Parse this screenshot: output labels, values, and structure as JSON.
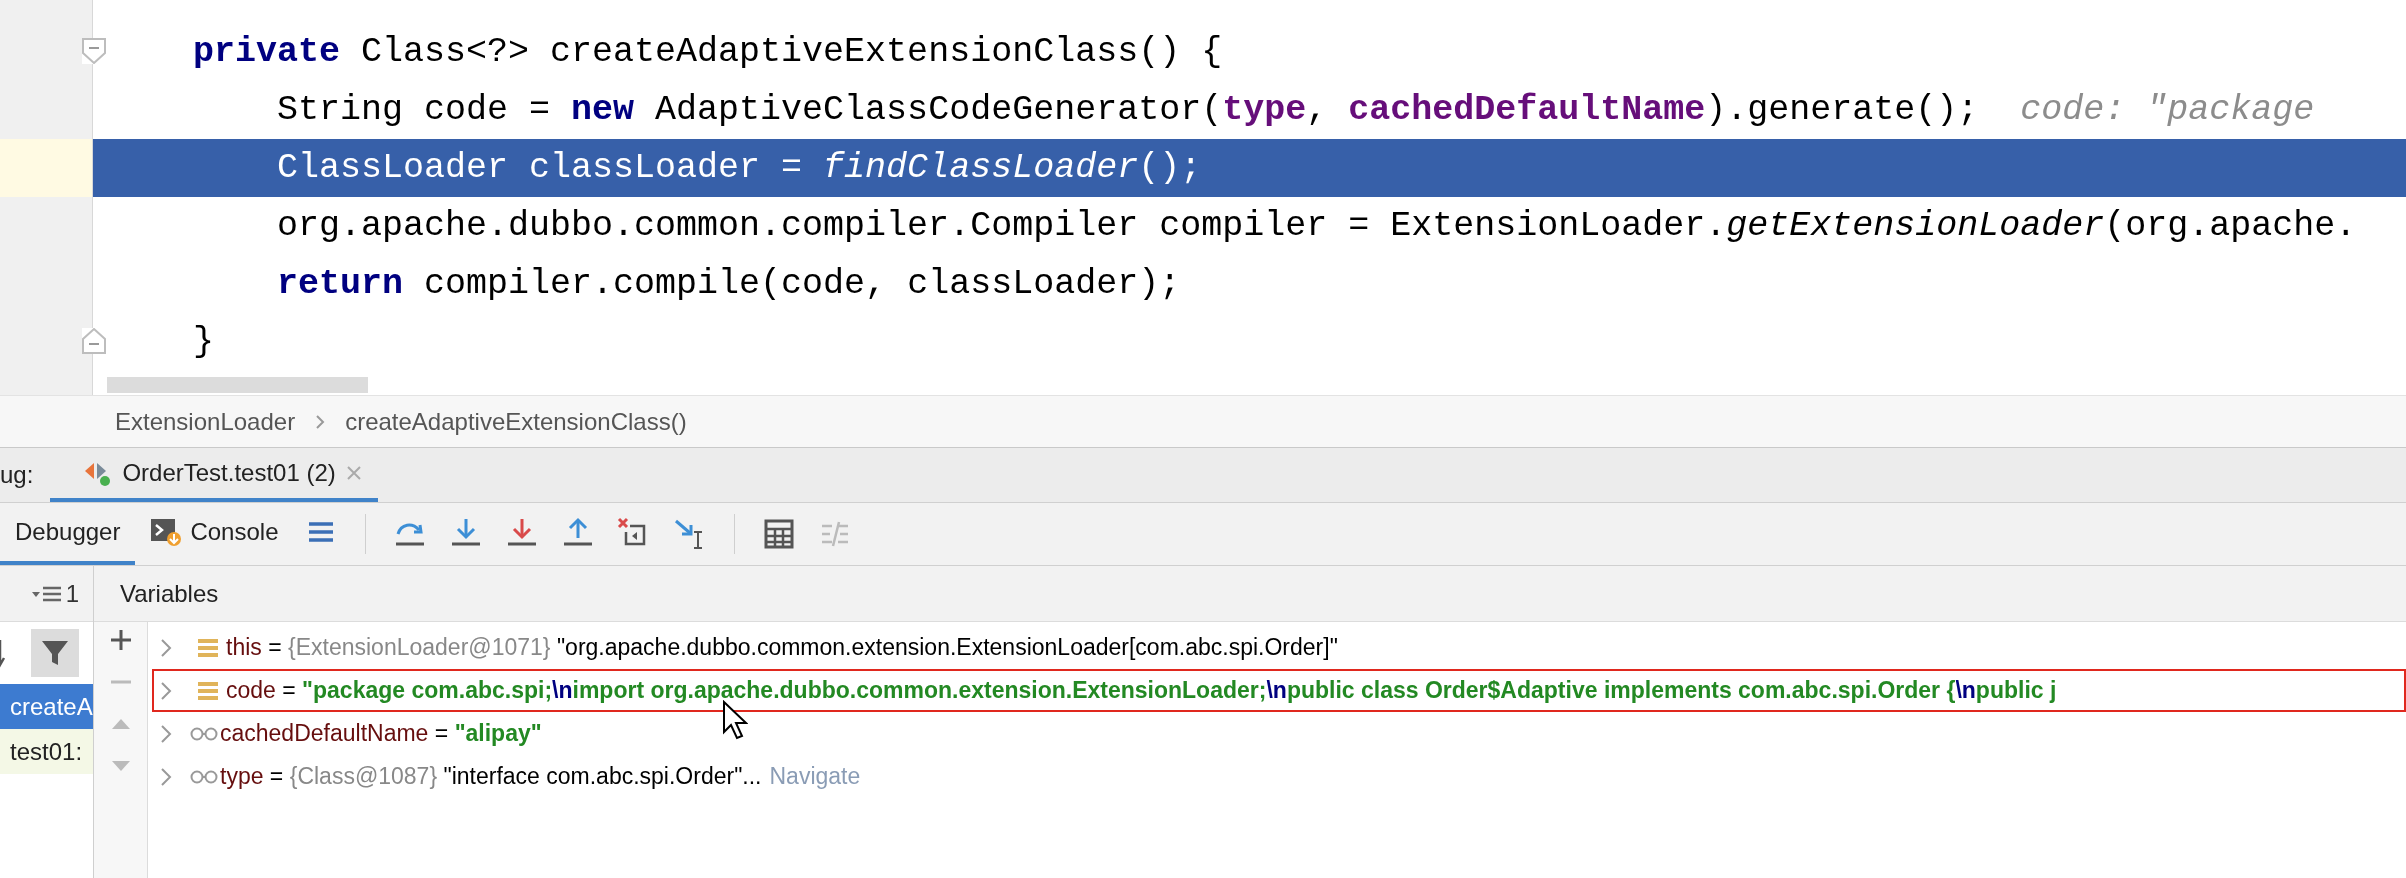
{
  "editor": {
    "lines": [
      {
        "segments": [
          {
            "text": "private",
            "kind": "keyword"
          },
          {
            "text": " Class<?> createAdaptiveExtensionClass() {",
            "kind": "plain"
          }
        ],
        "highlighted": false,
        "kind": "fold_start"
      },
      {
        "segments": [
          {
            "text": "    String code = ",
            "kind": "plain"
          },
          {
            "text": "new",
            "kind": "keyword"
          },
          {
            "text": " AdaptiveClassCodeGenerator(",
            "kind": "plain"
          },
          {
            "text": "type",
            "kind": "field"
          },
          {
            "text": ", ",
            "kind": "plain"
          },
          {
            "text": "cachedDefaultName",
            "kind": "field"
          },
          {
            "text": ").generate();",
            "kind": "plain"
          }
        ],
        "hint": "code: \"package",
        "highlighted": false,
        "kind": "code"
      },
      {
        "segments": [
          {
            "text": "    ClassLoader classLoader = ",
            "kind": "plain"
          },
          {
            "text": "findClassLoader",
            "kind": "italic"
          },
          {
            "text": "();",
            "kind": "plain"
          }
        ],
        "highlighted": true,
        "kind": "code"
      },
      {
        "segments": [
          {
            "text": "    org.apache.dubbo.common.compiler.Compiler compiler = ExtensionLoader.",
            "kind": "plain"
          },
          {
            "text": "getExtensionLoader",
            "kind": "italic"
          },
          {
            "text": "(org.apache.",
            "kind": "plain"
          }
        ],
        "highlighted": false,
        "kind": "code"
      },
      {
        "segments": [
          {
            "text": "    return",
            "kind": "keyword"
          },
          {
            "text": " compiler.compile(code, classLoader);",
            "kind": "plain"
          }
        ],
        "highlighted": false,
        "kind": "code"
      },
      {
        "segments": [
          {
            "text": "}",
            "kind": "plain"
          }
        ],
        "highlighted": false,
        "kind": "fold_end"
      }
    ]
  },
  "breadcrumbs": [
    "ExtensionLoader",
    "createAdaptiveExtensionClass()"
  ],
  "debug_bar": {
    "title_fragment": "ug:",
    "tabs": [
      {
        "label": "OrderTest.test01 (2)",
        "selected": true
      }
    ]
  },
  "toolbar": {
    "tabs": [
      {
        "label": "Debugger",
        "selected": true,
        "kind": "plain"
      },
      {
        "label": "Console",
        "selected": false,
        "kind": "console"
      }
    ]
  },
  "frames": {
    "header_label": "1",
    "items": [
      {
        "label": "createA",
        "selected": true
      },
      {
        "label": "test01:",
        "selected": false
      }
    ]
  },
  "variables": {
    "title": "Variables",
    "rows": [
      {
        "kind": "field",
        "name": "this",
        "operator": "=",
        "highlighted": false,
        "value": [
          {
            "text": "{ExtensionLoader@1071}",
            "kind": "ref"
          },
          {
            "text": " \"org.apache.dubbo.common.extension.ExtensionLoader[com.abc.spi.Order]\"",
            "kind": "plain"
          }
        ]
      },
      {
        "kind": "field",
        "name": "code",
        "operator": "=",
        "highlighted": true,
        "value": [
          {
            "text": "\"package com.abc.spi;",
            "kind": "string"
          },
          {
            "text": "\\n",
            "kind": "escape"
          },
          {
            "text": "import org.apache.dubbo.common.extension.ExtensionLoader;",
            "kind": "string"
          },
          {
            "text": "\\n",
            "kind": "escape"
          },
          {
            "text": "public class Order$Adaptive implements com.abc.spi.Order {",
            "kind": "string"
          },
          {
            "text": "\\n",
            "kind": "escape"
          },
          {
            "text": "public j",
            "kind": "string"
          }
        ]
      },
      {
        "kind": "local",
        "name": "cachedDefaultName",
        "operator": "=",
        "highlighted": false,
        "value": [
          {
            "text": "\"alipay\"",
            "kind": "string"
          }
        ]
      },
      {
        "kind": "local",
        "name": "type",
        "operator": "=",
        "highlighted": false,
        "value": [
          {
            "text": "{Class@1087}",
            "kind": "ref"
          },
          {
            "text": " \"interface com.abc.spi.Order\"...",
            "kind": "plain"
          }
        ],
        "link": "Navigate"
      }
    ]
  }
}
